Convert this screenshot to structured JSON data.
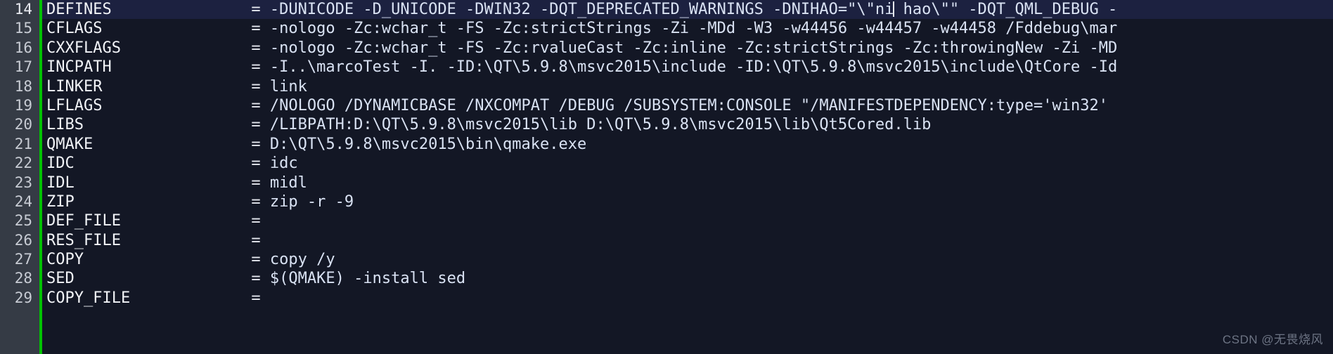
{
  "editor": {
    "theme": {
      "background": "#131725",
      "gutter_background": "#353b45",
      "gutter_text": "#c8ccd4",
      "change_marker": "#00c200",
      "current_line_background": "#1c2140",
      "text": "#e4e7ee",
      "value_text": "#d9e2f3"
    },
    "current_line_number": 14,
    "cursor": {
      "line": 14,
      "after_text": "-DNIHAO=\"\\\"ni"
    },
    "lines": [
      {
        "number": "14",
        "name": "DEFINES",
        "eq": "=",
        "value_before_cursor": "-DUNICODE -D_UNICODE -DWIN32 -DQT_DEPRECATED_WARNINGS -DNIHAO=\"\\\"ni",
        "value_after_cursor": " hao\\\"\" -DQT_QML_DEBUG -",
        "current": true
      },
      {
        "number": "15",
        "name": "CFLAGS",
        "eq": "=",
        "value": "-nologo -Zc:wchar_t -FS -Zc:strictStrings -Zi -MDd -W3 -w44456 -w44457 -w44458 /Fddebug\\mar",
        "current": false
      },
      {
        "number": "16",
        "name": "CXXFLAGS",
        "eq": "=",
        "value": "-nologo -Zc:wchar_t -FS -Zc:rvalueCast -Zc:inline -Zc:strictStrings -Zc:throwingNew -Zi -MD",
        "current": false
      },
      {
        "number": "17",
        "name": "INCPATH",
        "eq": "=",
        "value": "-I..\\marcoTest -I. -ID:\\QT\\5.9.8\\msvc2015\\include -ID:\\QT\\5.9.8\\msvc2015\\include\\QtCore -Id",
        "current": false
      },
      {
        "number": "18",
        "name": "LINKER",
        "eq": "=",
        "value": "link",
        "current": false
      },
      {
        "number": "19",
        "name": "LFLAGS",
        "eq": "=",
        "value": "/NOLOGO /DYNAMICBASE /NXCOMPAT /DEBUG /SUBSYSTEM:CONSOLE \"/MANIFESTDEPENDENCY:type='win32'",
        "current": false
      },
      {
        "number": "20",
        "name": "LIBS",
        "eq": "=",
        "value": "/LIBPATH:D:\\QT\\5.9.8\\msvc2015\\lib D:\\QT\\5.9.8\\msvc2015\\lib\\Qt5Cored.lib",
        "current": false
      },
      {
        "number": "21",
        "name": "QMAKE",
        "eq": "=",
        "value": "D:\\QT\\5.9.8\\msvc2015\\bin\\qmake.exe",
        "current": false
      },
      {
        "number": "22",
        "name": "IDC",
        "eq": "=",
        "value": "idc",
        "current": false
      },
      {
        "number": "23",
        "name": "IDL",
        "eq": "=",
        "value": "midl",
        "current": false
      },
      {
        "number": "24",
        "name": "ZIP",
        "eq": "=",
        "value": "zip -r -9",
        "current": false
      },
      {
        "number": "25",
        "name": "DEF_FILE",
        "eq": "=",
        "value": "",
        "current": false
      },
      {
        "number": "26",
        "name": "RES_FILE",
        "eq": "=",
        "value": "",
        "current": false
      },
      {
        "number": "27",
        "name": "COPY",
        "eq": "=",
        "value": "copy /y",
        "current": false
      },
      {
        "number": "28",
        "name": "SED",
        "eq": "=",
        "value": "$(QMAKE) -install sed",
        "current": false
      },
      {
        "number": "29",
        "name": "COPY_FILE",
        "eq": "=",
        "value": "",
        "current": false
      }
    ]
  },
  "watermark": {
    "text": "CSDN @无畏烧风"
  }
}
